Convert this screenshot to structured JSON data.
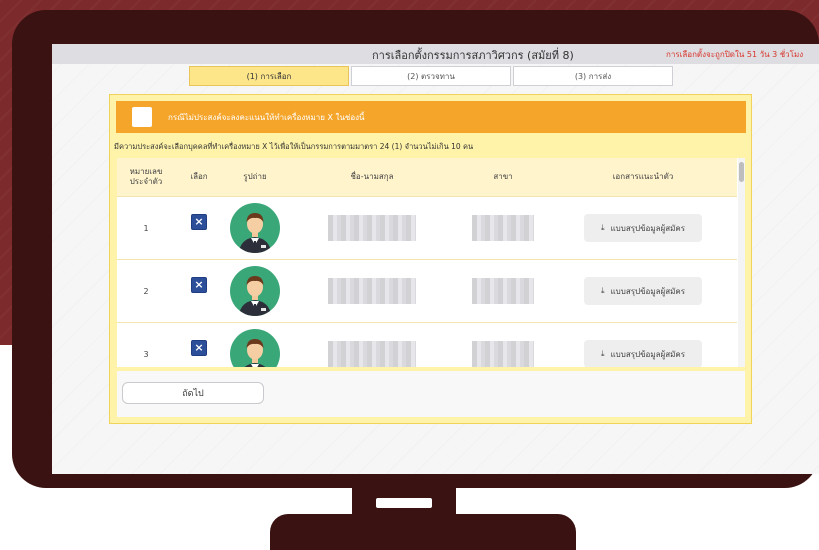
{
  "header": {
    "title": "การเลือกตั้งกรรมการสภาวิศวกร (สมัยที่ 8)",
    "deadline": "การเลือกตั้งจะถูกปิดใน 51 วัน 3 ชั่วโมง"
  },
  "steps": [
    {
      "label": "(1) การเลือก",
      "active": true
    },
    {
      "label": "(2) ตรวจทาน",
      "active": false
    },
    {
      "label": "(3) การส่ง",
      "active": false
    }
  ],
  "banner": {
    "text": "กรณีไม่ประสงค์จะลงคะแนนให้ทำเครื่องหมาย X ในช่องนี้"
  },
  "instruction": "มีความประสงค์จะเลือกบุคคลที่ทำเครื่องหมาย X ไว้เพื่อให้เป็นกรรมการตามมาตรา 24 (1) จำนวนไม่เกิน 10 คน",
  "table": {
    "columns": [
      "หมายเลข ประจำตัว",
      "เลือก",
      "รูปถ่าย",
      "ชื่อ-นามสกุล",
      "สาขา",
      "เอกสารแนะนำตัว"
    ],
    "rows": [
      {
        "number": "1",
        "checked": true,
        "doc_label": "แบบสรุปข้อมูลผู้สมัคร"
      },
      {
        "number": "2",
        "checked": true,
        "doc_label": "แบบสรุปข้อมูลผู้สมัคร"
      },
      {
        "number": "3",
        "checked": true,
        "doc_label": "แบบสรุปข้อมูลผู้สมัคร"
      }
    ]
  },
  "check_mark": "×",
  "download_icon": "⤓",
  "footer": {
    "next_label": "ถัดไป"
  },
  "colors": {
    "accent_orange": "#f5a52a",
    "card_yellow": "#fef3a8",
    "checkbox_blue": "#2d4f9a",
    "avatar_green": "#3aa779",
    "deadline_red": "#d9362b",
    "monitor_frame": "#3b1212"
  }
}
